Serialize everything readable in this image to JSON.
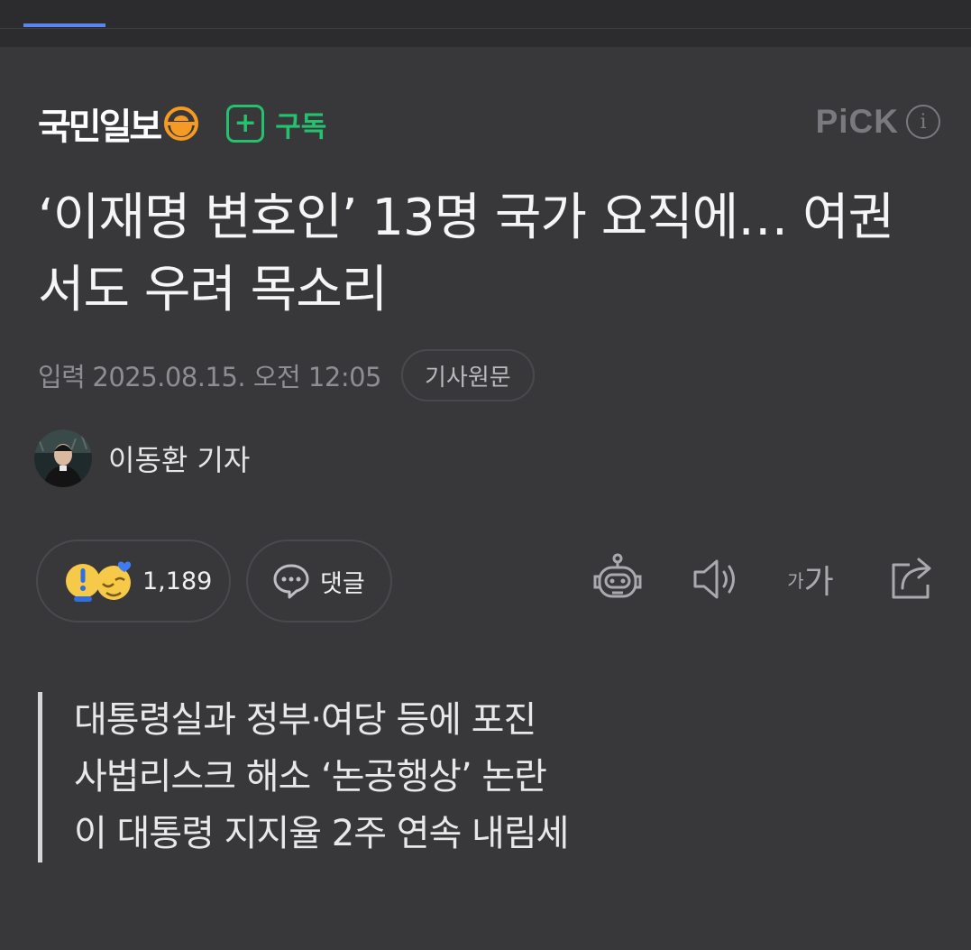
{
  "press": {
    "name": "국민일보",
    "subscribe_plus": "+",
    "subscribe_label": "구독",
    "pick_label": "PiCK",
    "pick_info_glyph": "i",
    "brand_color": "#25c16f"
  },
  "article": {
    "headline": "‘이재명 변호인’ 13명 국가 요직에… 여권서도 우려 목소리",
    "input_label": "입력",
    "input_datetime": "2025.08.15. 오전 12:05",
    "original_button": "기사원문",
    "reporter": "이동환 기자"
  },
  "actions": {
    "reaction_count": "1,189",
    "comment_label": "댓글",
    "font_small_glyph": "가",
    "font_big_glyph": "가"
  },
  "summary": {
    "lines": [
      "대통령실과 정부·여당 등에 포진",
      "사법리스크 해소 ‘논공행상’ 논란",
      "이 대통령 지지율 2주 연속 내림세"
    ]
  },
  "icons": {
    "emblem": "press-emblem-icon",
    "summary_bot": "summary-bot-icon",
    "speaker": "speaker-icon",
    "share": "share-icon",
    "comment": "comment-bubble-icon"
  }
}
